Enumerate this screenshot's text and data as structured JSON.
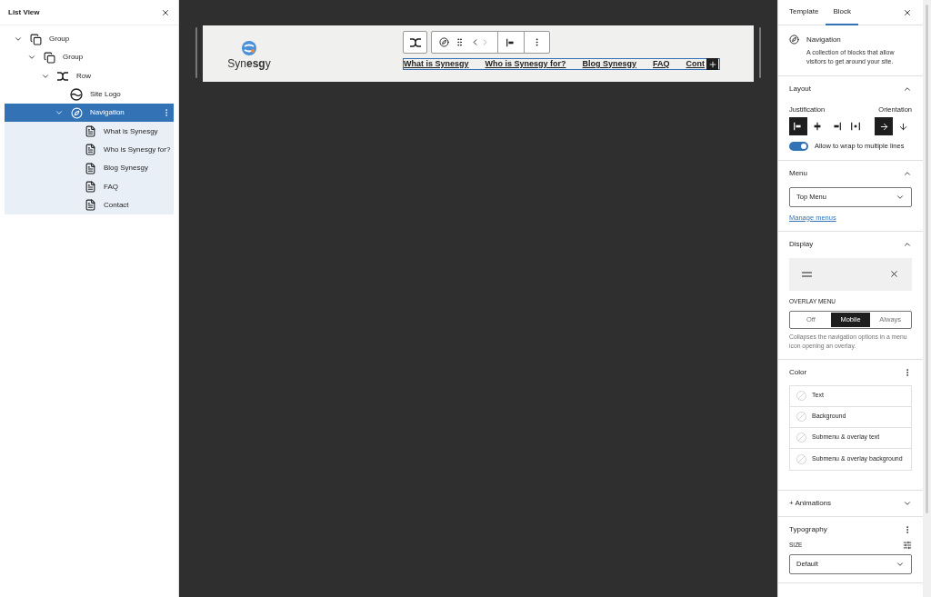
{
  "list_view": {
    "title": "List View",
    "tree": [
      {
        "label": "Group",
        "kind": "group",
        "expanded": true,
        "selected": false,
        "children": [
          {
            "label": "Group",
            "kind": "group",
            "expanded": true,
            "selected": false,
            "children": [
              {
                "label": "Row",
                "kind": "row",
                "expanded": true,
                "selected": false,
                "children": [
                  {
                    "label": "Site Logo",
                    "kind": "logo",
                    "selected": false
                  },
                  {
                    "label": "Navigation",
                    "kind": "navigation",
                    "expanded": true,
                    "selected": true,
                    "children": [
                      {
                        "label": "What is Synesgy",
                        "kind": "page",
                        "selected": false
                      },
                      {
                        "label": "Who is Synesgy for?",
                        "kind": "page",
                        "selected": false
                      },
                      {
                        "label": "Blog Synesgy",
                        "kind": "page",
                        "selected": false
                      },
                      {
                        "label": "FAQ",
                        "kind": "page",
                        "selected": false
                      },
                      {
                        "label": "Contact",
                        "kind": "page",
                        "selected": false
                      }
                    ]
                  }
                ]
              }
            ]
          }
        ]
      }
    ]
  },
  "canvas": {
    "logo_text": "Syn**esg**y",
    "nav_links": [
      "What is Synesgy",
      "Who is Synesgy for?",
      "Blog Synesgy",
      "FAQ",
      "Cont"
    ]
  },
  "settings": {
    "tabs": [
      {
        "label": "Template",
        "selected": false
      },
      {
        "label": "Block",
        "selected": true
      }
    ],
    "block": {
      "title": "Navigation",
      "description": "A collection of blocks that allow visitors to get around your site."
    },
    "layout": {
      "title": "Layout",
      "justification_label": "Justification",
      "orientation_label": "Orientation",
      "justification": [
        {
          "kind": "left",
          "selected": true
        },
        {
          "kind": "center",
          "selected": false
        },
        {
          "kind": "right",
          "selected": false
        },
        {
          "kind": "space",
          "selected": false
        }
      ],
      "orientation": [
        {
          "kind": "horizontal",
          "selected": true
        },
        {
          "kind": "vertical",
          "selected": false
        }
      ],
      "wrap": {
        "label": "Allow to wrap to multiple lines",
        "on": true
      }
    },
    "menu": {
      "title": "Menu",
      "value": "Top Menu",
      "link": "Manage menus"
    },
    "display": {
      "title": "Display",
      "overlay_label": "OVERLAY MENU",
      "overlay_options": [
        {
          "label": "Off",
          "selected": false
        },
        {
          "label": "Mobile",
          "selected": true
        },
        {
          "label": "Always",
          "selected": false
        }
      ],
      "help": "Collapses the navigation options in a menu icon opening an overlay."
    },
    "color": {
      "title": "Color",
      "items": [
        "Text",
        "Background",
        "Submenu & overlay text",
        "Submenu & overlay background"
      ]
    },
    "animations": {
      "title": "+ Animations"
    },
    "typography": {
      "title": "Typography",
      "size_label": "SIZE",
      "size_value": "Default"
    }
  }
}
